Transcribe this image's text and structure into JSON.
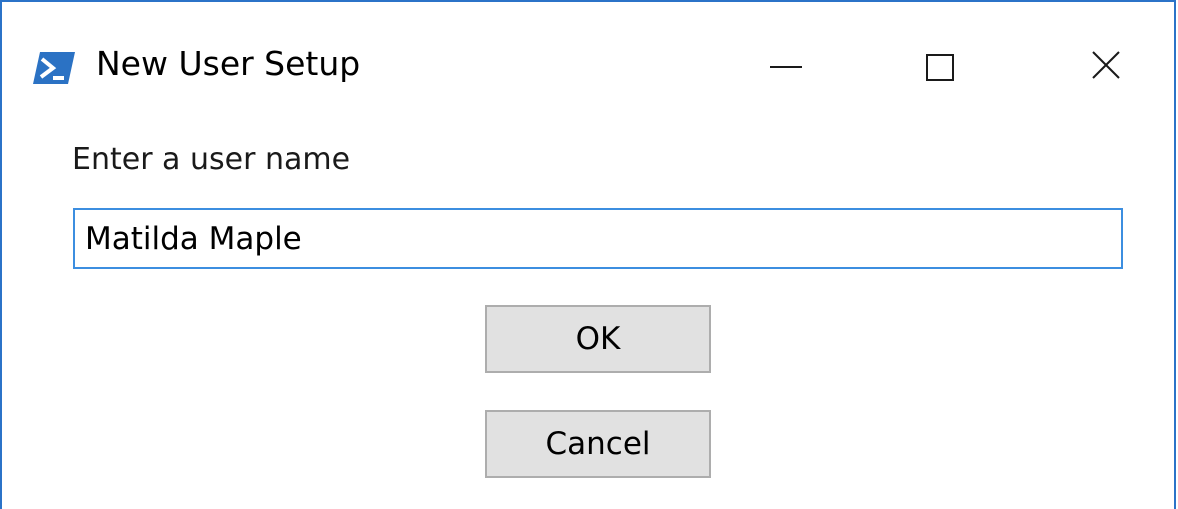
{
  "window": {
    "title": "New User Setup",
    "app_icon": "powershell-icon",
    "controls": {
      "minimize": "minimize-icon",
      "maximize": "maximize-icon",
      "close": "close-icon"
    },
    "accent_color": "#2b73c8"
  },
  "form": {
    "prompt": "Enter a user name",
    "username_value": "Matilda Maple",
    "ok_label": "OK",
    "cancel_label": "Cancel"
  }
}
